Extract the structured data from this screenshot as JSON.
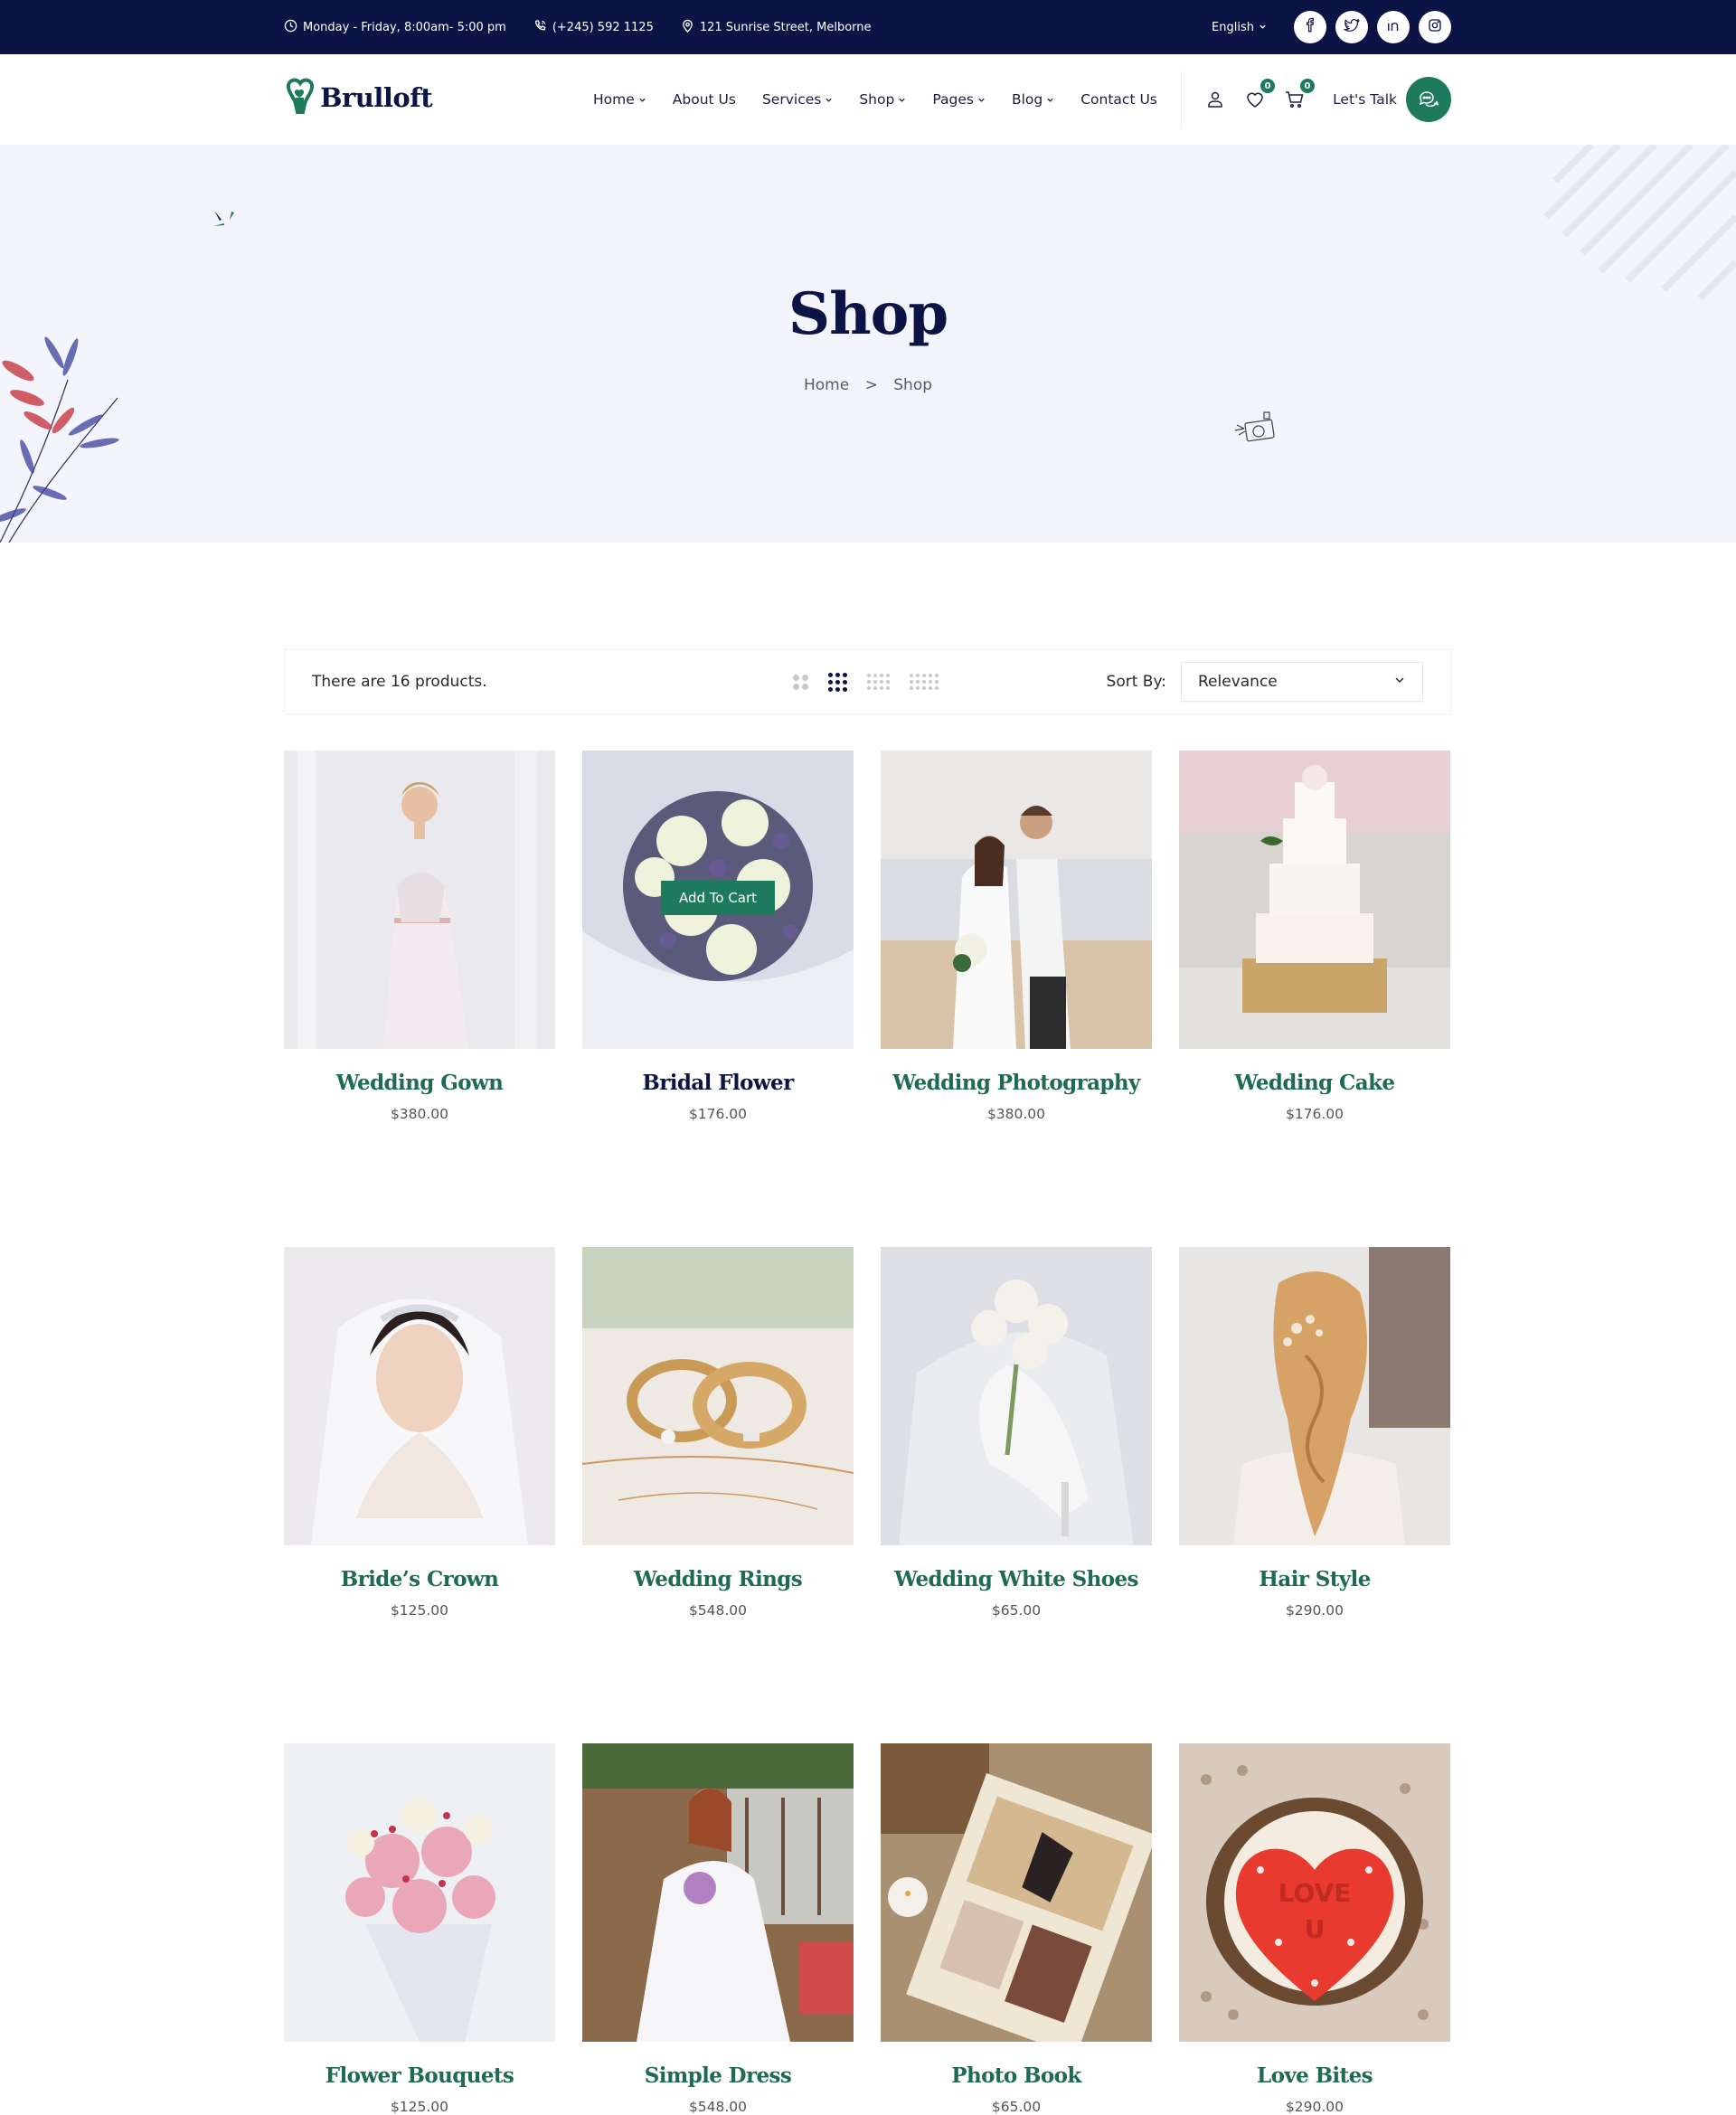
{
  "topbar": {
    "hours": "Monday - Friday, 8:00am- 5:00 pm",
    "phone": "(+245) 592 1125",
    "address": "121 Sunrise Street, Melborne",
    "language": "English",
    "social": [
      "facebook",
      "twitter",
      "linkedin",
      "instagram"
    ]
  },
  "header": {
    "logo": "Brulloft",
    "nav": [
      {
        "label": "Home",
        "dropdown": true
      },
      {
        "label": "About Us",
        "dropdown": false
      },
      {
        "label": "Services",
        "dropdown": true
      },
      {
        "label": "Shop",
        "dropdown": true
      },
      {
        "label": "Pages",
        "dropdown": true
      },
      {
        "label": "Blog",
        "dropdown": true
      },
      {
        "label": "Contact Us",
        "dropdown": false
      }
    ],
    "wishlist_count": "0",
    "cart_count": "0",
    "cta_label": "Let's Talk"
  },
  "hero": {
    "title": "Shop",
    "breadcrumb": {
      "home": "Home",
      "separator": ">",
      "current": "Shop"
    }
  },
  "toolbar": {
    "count_text": "There are 16 products.",
    "views": [
      "2-column",
      "3-column",
      "4-column",
      "5-column"
    ],
    "active_view": "3-column",
    "sort_label": "Sort By:",
    "sort_value": "Relevance"
  },
  "colors": {
    "navy": "#0b1445",
    "green": "#1e7a5c",
    "hero_bg": "#f4f5fc"
  },
  "products": [
    {
      "title": "Wedding Gown",
      "price": "$380.00",
      "image": "bride-in-lace-gown"
    },
    {
      "title": "Bridal Flower",
      "price": "$176.00",
      "image": "white-rose-lavender-bouquet",
      "hover_button": "Add To Cart"
    },
    {
      "title": "Wedding Photography",
      "price": "$380.00",
      "image": "couple-on-beach"
    },
    {
      "title": "Wedding Cake",
      "price": "$176.00",
      "image": "tiered-white-cake"
    },
    {
      "title": "Bride’s Crown",
      "price": "$125.00",
      "image": "bride-with-tiara"
    },
    {
      "title": "Wedding Rings",
      "price": "$548.00",
      "image": "gold-rings"
    },
    {
      "title": "Wedding White Shoes",
      "price": "$65.00",
      "image": "white-heels-with-roses"
    },
    {
      "title": "Hair Style",
      "price": "$290.00",
      "image": "braided-blonde-hair"
    },
    {
      "title": "Flower Bouquets",
      "price": "$125.00",
      "image": "pink-flower-bouquet"
    },
    {
      "title": "Simple Dress",
      "price": "$548.00",
      "image": "bride-in-garden"
    },
    {
      "title": "Photo Book",
      "price": "$65.00",
      "image": "scrapbook-album"
    },
    {
      "title": "Love Bites",
      "price": "$290.00",
      "image": "heart-cupcake"
    }
  ]
}
